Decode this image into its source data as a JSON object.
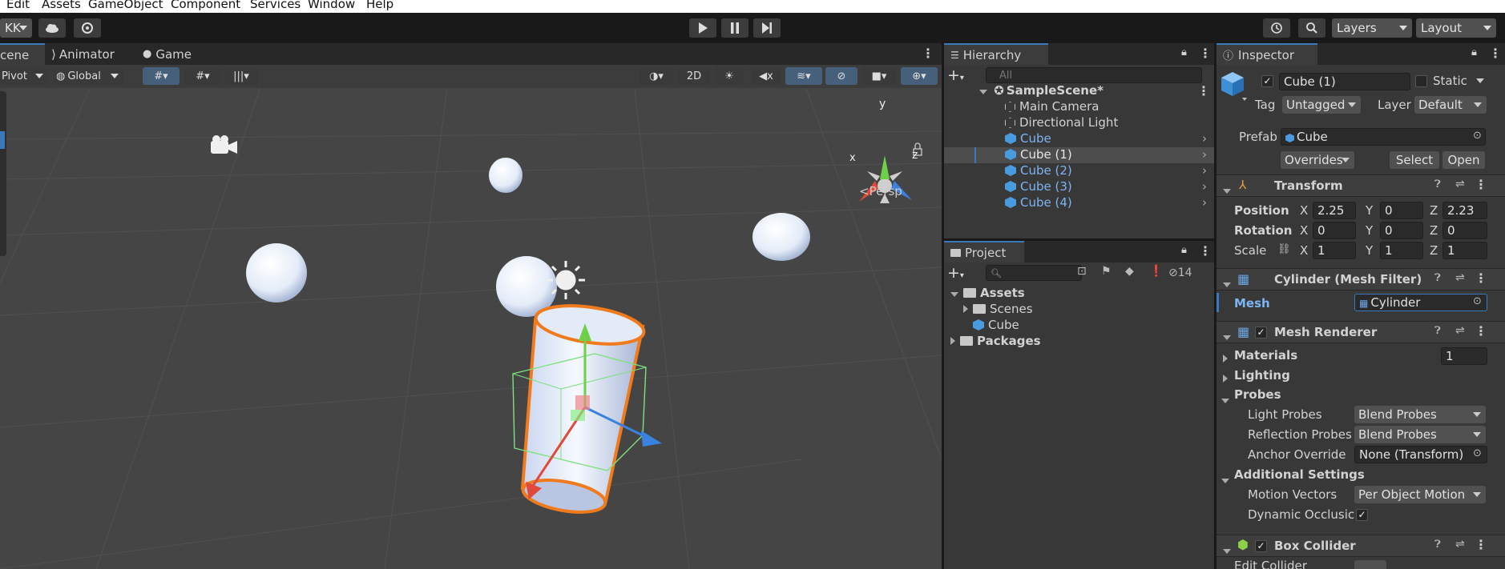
{
  "menu": [
    "Edit",
    "Assets",
    "GameObject",
    "Component",
    "Services",
    "Window",
    "Help"
  ],
  "toolbar": {
    "account": "KK",
    "layers": "Layers",
    "layout": "Layout"
  },
  "scene_panel": {
    "tabs": [
      "cene",
      "Animator",
      "Game"
    ],
    "pivot": "Pivot",
    "global": "Global",
    "mode_2d": "2D",
    "persp": "Persp",
    "gizmo_axes": {
      "x": "x",
      "y": "y",
      "z": "z"
    }
  },
  "hierarchy": {
    "title": "Hierarchy",
    "search_placeholder": "All",
    "scene": "SampleScene*",
    "items": [
      {
        "label": "Main Camera",
        "prefab": false,
        "selected": false
      },
      {
        "label": "Directional Light",
        "prefab": false,
        "selected": false
      },
      {
        "label": "Cube",
        "prefab": true,
        "selected": false
      },
      {
        "label": "Cube (1)",
        "prefab": true,
        "selected": true
      },
      {
        "label": "Cube (2)",
        "prefab": true,
        "selected": false
      },
      {
        "label": "Cube (3)",
        "prefab": true,
        "selected": false
      },
      {
        "label": "Cube (4)",
        "prefab": true,
        "selected": false
      }
    ]
  },
  "project": {
    "title": "Project",
    "hidden_count": "14",
    "assets": "Assets",
    "scenes": "Scenes",
    "cube": "Cube",
    "packages": "Packages"
  },
  "inspector": {
    "title": "Inspector",
    "object_name": "Cube (1)",
    "static": "Static",
    "tag_label": "Tag",
    "tag_value": "Untagged",
    "layer_label": "Layer",
    "layer_value": "Default",
    "prefab_label": "Prefab",
    "prefab_value": "Cube",
    "overrides": "Overrides",
    "select": "Select",
    "open": "Open",
    "transform": {
      "title": "Transform",
      "position_label": "Position",
      "rotation_label": "Rotation",
      "scale_label": "Scale",
      "position": {
        "x": "2.25",
        "y": "0",
        "z": "2.23"
      },
      "rotation": {
        "x": "0",
        "y": "0",
        "z": "0"
      },
      "scale": {
        "x": "1",
        "y": "1",
        "z": "1"
      }
    },
    "mesh_filter": {
      "title": "Cylinder (Mesh Filter)",
      "mesh_label": "Mesh",
      "mesh_value": "Cylinder"
    },
    "mesh_renderer": {
      "title": "Mesh Renderer",
      "materials": "Materials",
      "materials_count": "1",
      "lighting": "Lighting",
      "probes": "Probes",
      "light_probes_label": "Light Probes",
      "light_probes_value": "Blend Probes",
      "reflection_probes_label": "Reflection Probes",
      "reflection_probes_value": "Blend Probes",
      "anchor_override_label": "Anchor Override",
      "anchor_override_value": "None (Transform)",
      "additional_settings": "Additional Settings",
      "motion_vectors_label": "Motion Vectors",
      "motion_vectors_value": "Per Object Motion",
      "dynamic_occlusion_label": "Dynamic Occlusic"
    },
    "box_collider": {
      "title": "Box Collider",
      "edit_collider": "Edit Collider"
    }
  },
  "colors": {
    "accent": "#3a79bb",
    "prefab_blue": "#7cb5f2",
    "selection": "#2c5d87",
    "scene_bg": "#454545",
    "panel_bg": "#383838",
    "outline_orange": "#f07a1c"
  }
}
